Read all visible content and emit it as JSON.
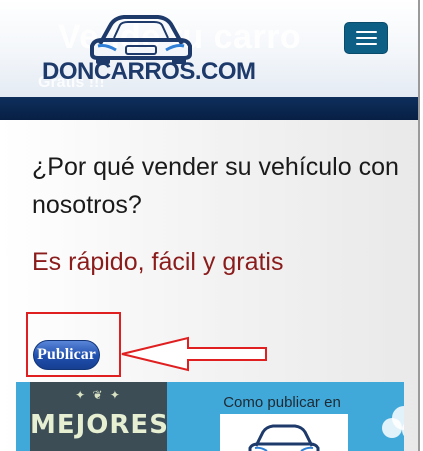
{
  "header": {
    "background_title": "Vende tu carro",
    "background_subtitle": "Gratis !!!",
    "brand_name": "DONCARROS.COM",
    "menu_toggle_icon": "hamburger-menu-icon"
  },
  "main": {
    "heading": "¿Por qué vender su vehículo con nosotros?",
    "tagline": "Es rápido, fácil y gratis",
    "publish_button_label": "Publicar"
  },
  "annotation": {
    "arrow_icon": "left-arrow-icon",
    "color": "#e02020"
  },
  "banner": {
    "left_text": "MEJORES",
    "caption": "Como publicar en"
  },
  "colors": {
    "brand_navy": "#1d3a6b",
    "navbar": "#0e2f5c",
    "menu_button": "#0d5f86",
    "tagline_red": "#8b1c1c",
    "publish_button": "#1f4fae",
    "banner_blue": "#41a9d9"
  }
}
